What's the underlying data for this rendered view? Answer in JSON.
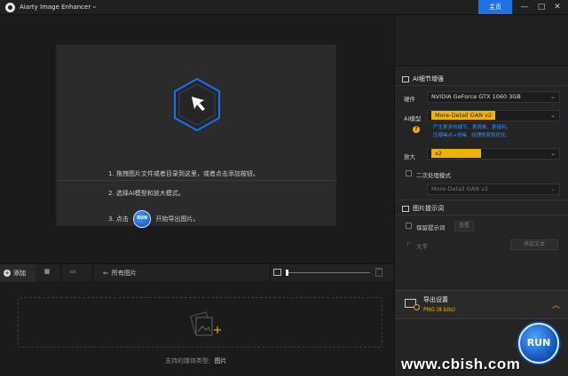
{
  "app": {
    "title": "Aiarty Image Enhancer",
    "home_label": "主页",
    "window_controls": [
      "—",
      "□",
      "✕"
    ]
  },
  "drop_panel": {
    "step1": "1. 拖拽图片文件或者目录到这里，或者点击添加按钮。",
    "step2": "2. 选择AI模型和放大模式。",
    "step3_prefix": "3. 点击",
    "step3_run": "RUN",
    "step3_suffix": "开始导出图片。"
  },
  "toolbar": {
    "add_label": "添加",
    "all_images_label": "所有图片",
    "zoom_fraction": 0.0
  },
  "thumb_area": {
    "support_label": "支持的媒体类型:",
    "support_value": "图片"
  },
  "right_panel": {
    "enhance_title": "AI细节增强",
    "hardware_label": "硬件",
    "hardware_value": "NVIDIA GeForce GTX 1060 3GB",
    "model_label": "AI模型",
    "model_value": "More-Detail GAN v2",
    "model_desc_1": "产生更多的细节、更清晰、更锐利。",
    "model_desc_2": "压缩噪点+去噪、纹理修复和优化。",
    "upscale_label": "放大",
    "upscale_value": "x2",
    "second_pass_label": "二次处理模式",
    "second_pass_value": "More-Detail GAN v2",
    "prompt_title": "图片提示词",
    "keep_prompt_label": "保留提示词",
    "view_label": "查看",
    "text_label": "文字",
    "add_text_label": "添加文本",
    "export_title": "导出设置",
    "export_value": "PNG  (8 bits)",
    "run_label": "RUN"
  },
  "watermark": "www.cbish.com",
  "colors": {
    "accent_blue": "#1d72e8",
    "accent_orange": "#f0b400",
    "background": "#1b1b1b"
  }
}
